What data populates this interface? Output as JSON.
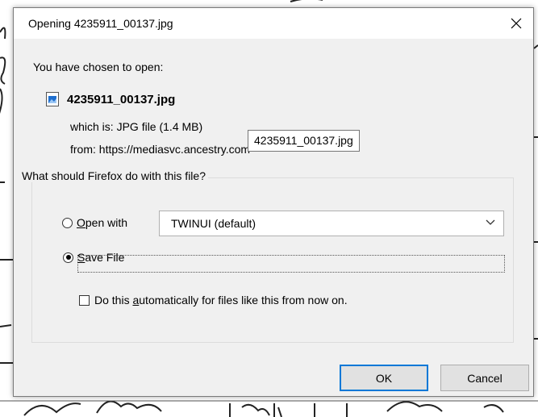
{
  "dialog": {
    "title": "Opening 4235911_00137.jpg",
    "intro": "You have chosen to open:",
    "file_name": "4235911_00137.jpg",
    "which_is_label": "which is:",
    "which_is_value": "JPG file (1.4 MB)",
    "from_label": "from:",
    "from_value": "https://mediasvc.ancestry.com",
    "tooltip": "4235911_00137.jpg",
    "group_title": "What should Firefox do with this file?",
    "open_with_label": "Open with",
    "open_with_value": "TWINUI (default)",
    "open_with_checked": false,
    "save_file_label": "Save File",
    "save_file_checked": true,
    "auto_checkbox_label": "Do this automatically for files like this from now on.",
    "auto_checked": false,
    "ok_label": "OK",
    "cancel_label": "Cancel"
  },
  "icons": {
    "close": "close-icon",
    "file": "image-file-icon",
    "dropdown": "chevron-down-icon"
  },
  "colors": {
    "dialog_bg": "#f0f0f0",
    "titlebar_bg": "#ffffff",
    "accent_focus": "#0078d7",
    "file_icon_blue": "#1f6fcf"
  }
}
